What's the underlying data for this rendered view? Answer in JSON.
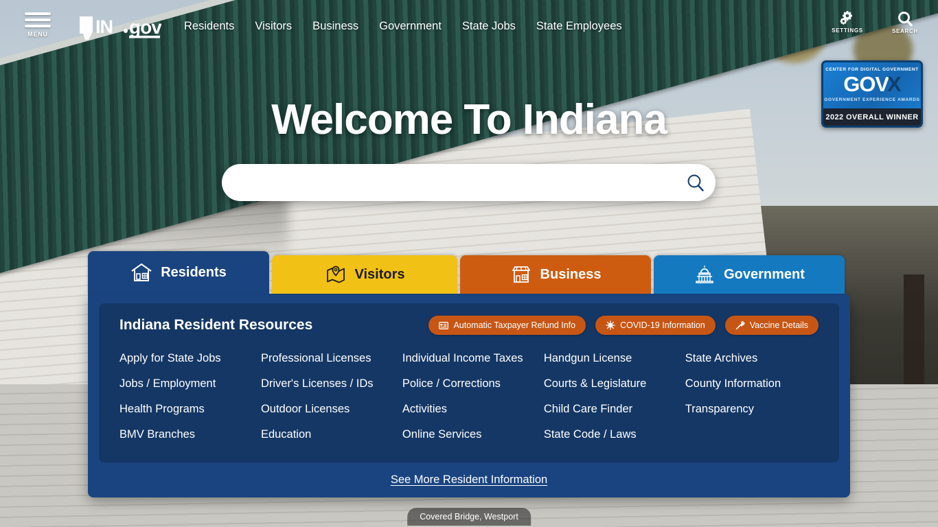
{
  "header": {
    "menu_label": "MENU",
    "logo_text": "IN.gov",
    "nav": [
      {
        "label": "Residents"
      },
      {
        "label": "Visitors"
      },
      {
        "label": "Business"
      },
      {
        "label": "Government"
      },
      {
        "label": "State Jobs"
      },
      {
        "label": "State Employees"
      }
    ],
    "icons": [
      {
        "name": "settings-icon",
        "label": "SETTINGS"
      },
      {
        "name": "search-icon",
        "label": "SEARCH"
      }
    ]
  },
  "award_badge": {
    "line1": "CENTER FOR DIGITAL GOVERNMENT",
    "line2": "GOV",
    "line2_mark": "X",
    "line3": "GOVERNMENT EXPERIENCE AWARDS",
    "line4": "2022 OVERALL WINNER"
  },
  "hero": {
    "title": "Welcome To Indiana",
    "search": {
      "value": "",
      "placeholder": "",
      "button_icon": "search-icon"
    }
  },
  "audience_tabs": [
    {
      "label": "Residents",
      "icon": "house-icon",
      "color": "#1a4480",
      "active": true
    },
    {
      "label": "Visitors",
      "icon": "map-pin-icon",
      "color": "#f2c116",
      "active": false
    },
    {
      "label": "Business",
      "icon": "storefront-icon",
      "color": "#ce5c10",
      "active": false
    },
    {
      "label": "Government",
      "icon": "capitol-icon",
      "color": "#1579c0",
      "active": false
    }
  ],
  "panel": {
    "title": "Indiana Resident Resources",
    "pills": [
      {
        "label": "Automatic Taxpayer Refund Info",
        "icon": "money-check-icon"
      },
      {
        "label": "COVID-19 Information",
        "icon": "virus-icon"
      },
      {
        "label": "Vaccine Details",
        "icon": "syringe-icon"
      }
    ],
    "columns": [
      {
        "links": [
          {
            "label": "Apply for State Jobs"
          },
          {
            "label": "Jobs / Employment"
          },
          {
            "label": "Health Programs"
          },
          {
            "label": "BMV Branches"
          }
        ]
      },
      {
        "links": [
          {
            "label": "Professional Licenses"
          },
          {
            "label": "Driver's Licenses / IDs"
          },
          {
            "label": "Outdoor Licenses"
          },
          {
            "label": "Education"
          }
        ]
      },
      {
        "links": [
          {
            "label": "Individual Income Taxes"
          },
          {
            "label": "Police / Corrections"
          },
          {
            "label": "Activities"
          },
          {
            "label": "Online Services"
          }
        ]
      },
      {
        "links": [
          {
            "label": "Handgun License"
          },
          {
            "label": "Courts & Legislature"
          },
          {
            "label": "Child Care Finder"
          },
          {
            "label": "State Code / Laws"
          }
        ]
      },
      {
        "links": [
          {
            "label": "State Archives"
          },
          {
            "label": "County Information"
          },
          {
            "label": "Transparency"
          }
        ]
      }
    ],
    "footer_link": "See More Resident Information"
  },
  "photo_caption": "Covered Bridge, Westport",
  "colors": {
    "panel_outer": "#1a4480",
    "panel_inner": "#153765",
    "pill": "#c75615",
    "tab_visitors": "#f2c116",
    "tab_business": "#ce5c10",
    "tab_government": "#1579c0"
  }
}
